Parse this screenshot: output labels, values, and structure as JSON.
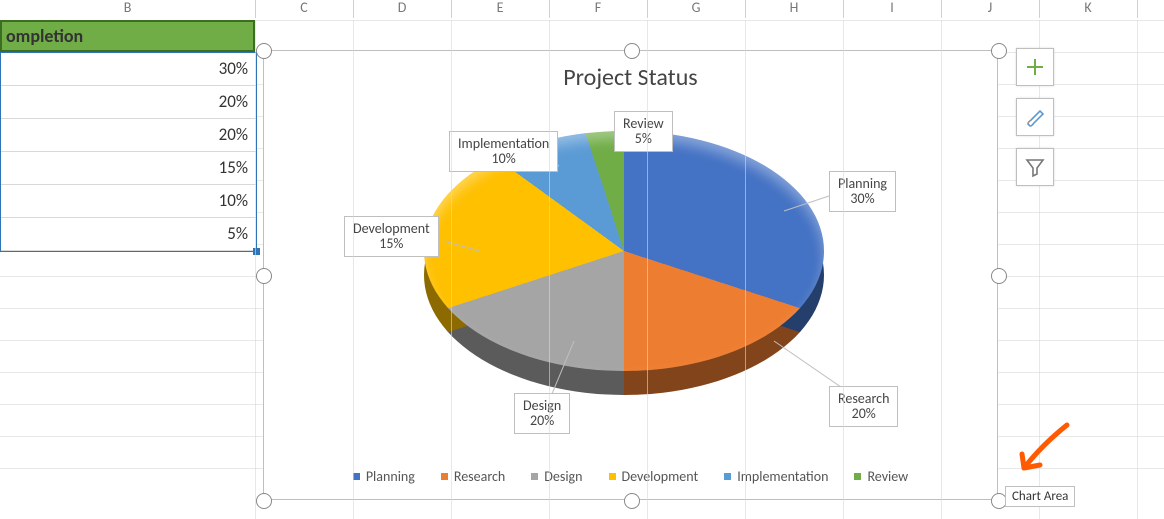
{
  "column_letters": [
    "B",
    "C",
    "D",
    "E",
    "F",
    "G",
    "H",
    "I",
    "J",
    "K"
  ],
  "column_edges": [
    0,
    255,
    353,
    451,
    549,
    647,
    745,
    843,
    941,
    1039,
    1137
  ],
  "header_cell": "ompletion",
  "data_cells": [
    "30%",
    "20%",
    "20%",
    "15%",
    "10%",
    "5%"
  ],
  "chart_data": {
    "type": "pie",
    "title": "Project Status",
    "categories": [
      "Planning",
      "Research",
      "Design",
      "Development",
      "Implementation",
      "Review"
    ],
    "values": [
      30,
      20,
      20,
      15,
      10,
      5
    ],
    "colors": [
      "#4472C4",
      "#ED7D31",
      "#A5A5A5",
      "#FFC000",
      "#5B9BD5",
      "#70AD47"
    ],
    "data_labels": [
      {
        "name": "Planning",
        "pct": "30%"
      },
      {
        "name": "Research",
        "pct": "20%"
      },
      {
        "name": "Design",
        "pct": "20%"
      },
      {
        "name": "Development",
        "pct": "15%"
      },
      {
        "name": "Implementation",
        "pct": "10%"
      },
      {
        "name": "Review",
        "pct": "5%"
      }
    ],
    "legend": [
      "Planning",
      "Research",
      "Design",
      "Development",
      "Implementation",
      "Review"
    ]
  },
  "tooltip": "Chart Area",
  "tool_buttons": [
    "plus-icon",
    "paintbrush-icon",
    "funnel-icon"
  ]
}
